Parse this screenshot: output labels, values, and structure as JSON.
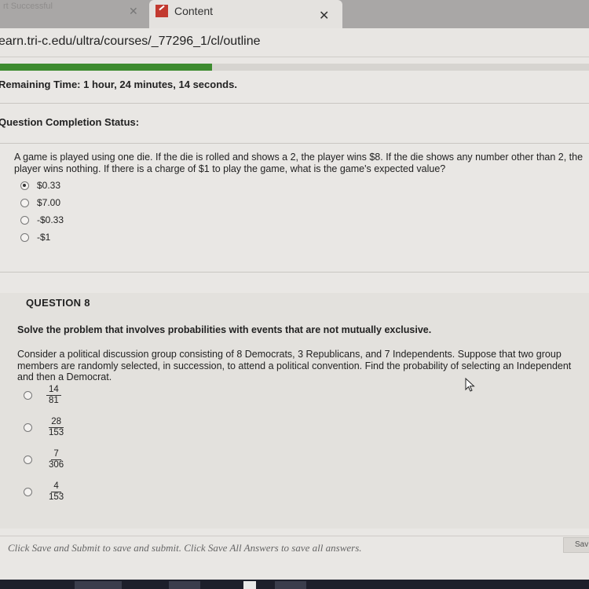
{
  "browser": {
    "inactive_tab_label": "rt Successful",
    "active_tab_label": "Content",
    "close_glyph": "✕",
    "url": "earn.tri-c.edu/ultra/courses/_77296_1/cl/outline"
  },
  "test": {
    "progress_fraction": 0.36,
    "timer_label": "Remaining Time:",
    "timer_value": "1 hour, 24 minutes, 14 seconds.",
    "completion_status_label": "Question Completion Status:"
  },
  "question7": {
    "text": "A game is played using one die. If the die is rolled and shows a 2, the player wins $8. If the die shows any number other than 2, the player wins nothing. If there is a charge of $1 to play the game, what is the game's expected value?",
    "options": [
      {
        "label": "$0.33",
        "selected": true
      },
      {
        "label": "$7.00",
        "selected": false
      },
      {
        "label": "-$0.33",
        "selected": false
      },
      {
        "label": "-$1",
        "selected": false
      }
    ]
  },
  "question8": {
    "title": "QUESTION 8",
    "instruction": "Solve the problem that involves probabilities with events that are not mutually exclusive.",
    "text": "Consider a political discussion group consisting of 8 Democrats, 3 Republicans, and 7 Independents. Suppose that two group members are randomly selected, in succession, to attend a political convention. Find the probability of selecting an Independent and then a Democrat.",
    "options": [
      {
        "num": "14",
        "den": "81"
      },
      {
        "num": "28",
        "den": "153"
      },
      {
        "num": "7",
        "den": "306"
      },
      {
        "num": "4",
        "den": "153"
      }
    ]
  },
  "footer": {
    "instruction": "Click Save and Submit to save and submit. Click Save All Answers to save all answers.",
    "save_button": "Sav"
  },
  "colors": {
    "progress": "#3d8b2f",
    "tab_favicon": "#c23a30"
  }
}
